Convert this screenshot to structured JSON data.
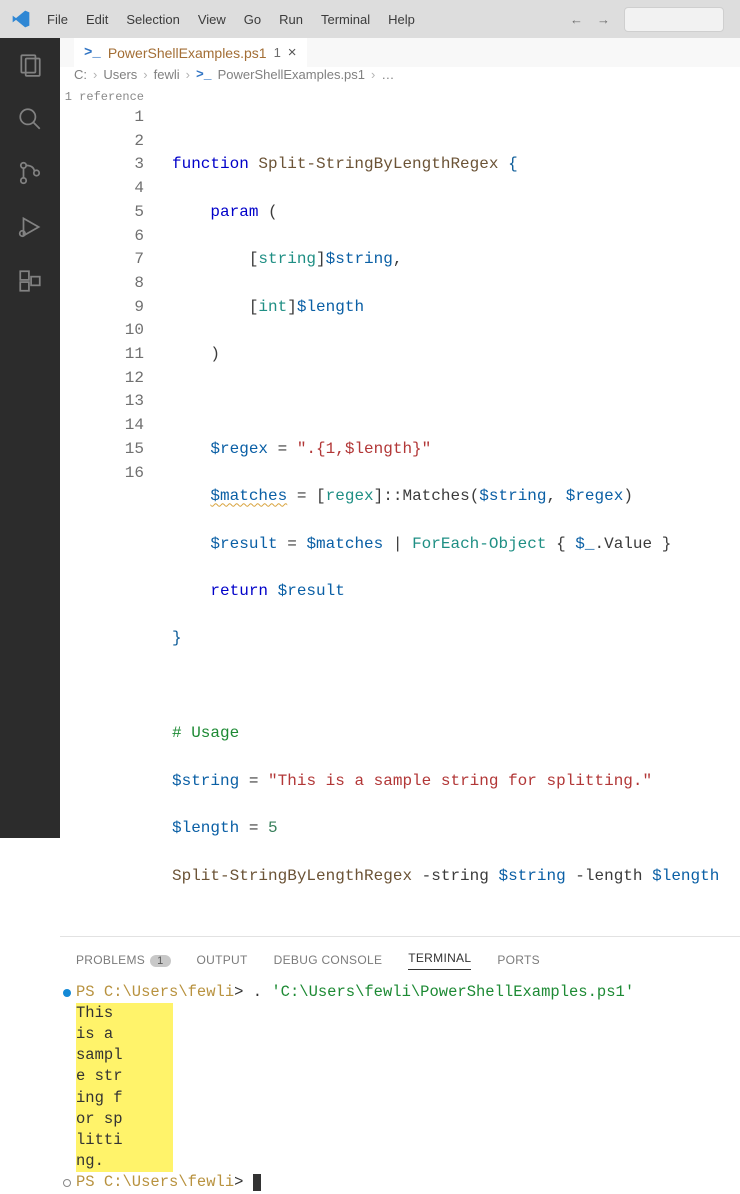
{
  "menubar": {
    "items": [
      "File",
      "Edit",
      "Selection",
      "View",
      "Go",
      "Run",
      "Terminal",
      "Help"
    ]
  },
  "tab": {
    "filename": "PowerShellExamples.ps1",
    "dirty_indicator": "1",
    "close_glyph": "×",
    "prompt_glyph": ">_"
  },
  "breadcrumbs": {
    "segments": [
      "C:",
      "Users",
      "fewli",
      "PowerShellExamples.ps1",
      "…"
    ]
  },
  "codelens": "1 reference",
  "code": {
    "lines": [
      "1",
      "2",
      "3",
      "4",
      "5",
      "6",
      "7",
      "8",
      "9",
      "10",
      "11",
      "12",
      "13",
      "14",
      "15",
      "16"
    ],
    "l1_function": "function",
    "l1_name": " Split-StringByLengthRegex ",
    "l1_brace": "{",
    "l2_param": "param ",
    "l2_paren": "(",
    "l3_lb": "[",
    "l3_type": "string",
    "l3_rb": "]",
    "l3_var": "$string",
    "l3_comma": ",",
    "l4_lb": "[",
    "l4_type": "int",
    "l4_rb": "]",
    "l4_var": "$length",
    "l5_paren": ")",
    "l7_var": "$regex",
    "l7_eq": " = ",
    "l7_str": "\".{1,$length}\"",
    "l8_var": "$matches",
    "l8_eq": " = ",
    "l8_lb": "[",
    "l8_type": "regex",
    "l8_rb": "]",
    "l8_method": "::Matches",
    "l8_lp": "(",
    "l8_arg1": "$string",
    "l8_comma": ", ",
    "l8_arg2": "$regex",
    "l8_rp": ")",
    "l9_var": "$result",
    "l9_eq": " = ",
    "l9_matches": "$matches",
    "l9_pipe": " | ",
    "l9_cmd": "ForEach-Object",
    "l9_lb": " { ",
    "l9_pv": "$_",
    "l9_val": ".Value",
    "l9_rb": " }",
    "l10_return": "return",
    "l10_var": " $result",
    "l11_brace": "}",
    "l13_comment": "# Usage",
    "l14_var": "$string",
    "l14_eq": " = ",
    "l14_str": "\"This is a sample string for splitting.\"",
    "l15_var": "$length",
    "l15_eq": " = ",
    "l15_num": "5",
    "l16_fn": "Split-StringByLengthRegex",
    "l16_p1": " -string ",
    "l16_a1": "$string",
    "l16_p2": " -length ",
    "l16_a2": "$length"
  },
  "panel": {
    "tabs": {
      "problems": "PROBLEMS",
      "problems_count": "1",
      "output": "OUTPUT",
      "debug": "DEBUG CONSOLE",
      "terminal": "TERMINAL",
      "ports": "PORTS"
    }
  },
  "terminal": {
    "prompt1_prefix": "PS ",
    "prompt1_path": "C:\\Users\\fewli",
    "prompt1_arrow": "> ",
    "prompt1_dot": ". ",
    "prompt1_cmd": "'C:\\Users\\fewli\\PowerShellExamples.ps1'",
    "output": [
      "This ",
      "is a ",
      "sampl",
      "e str",
      "ing f",
      "or sp",
      "litti",
      "ng."
    ],
    "prompt2_prefix": "PS ",
    "prompt2_path": "C:\\Users\\fewli",
    "prompt2_arrow": "> "
  }
}
